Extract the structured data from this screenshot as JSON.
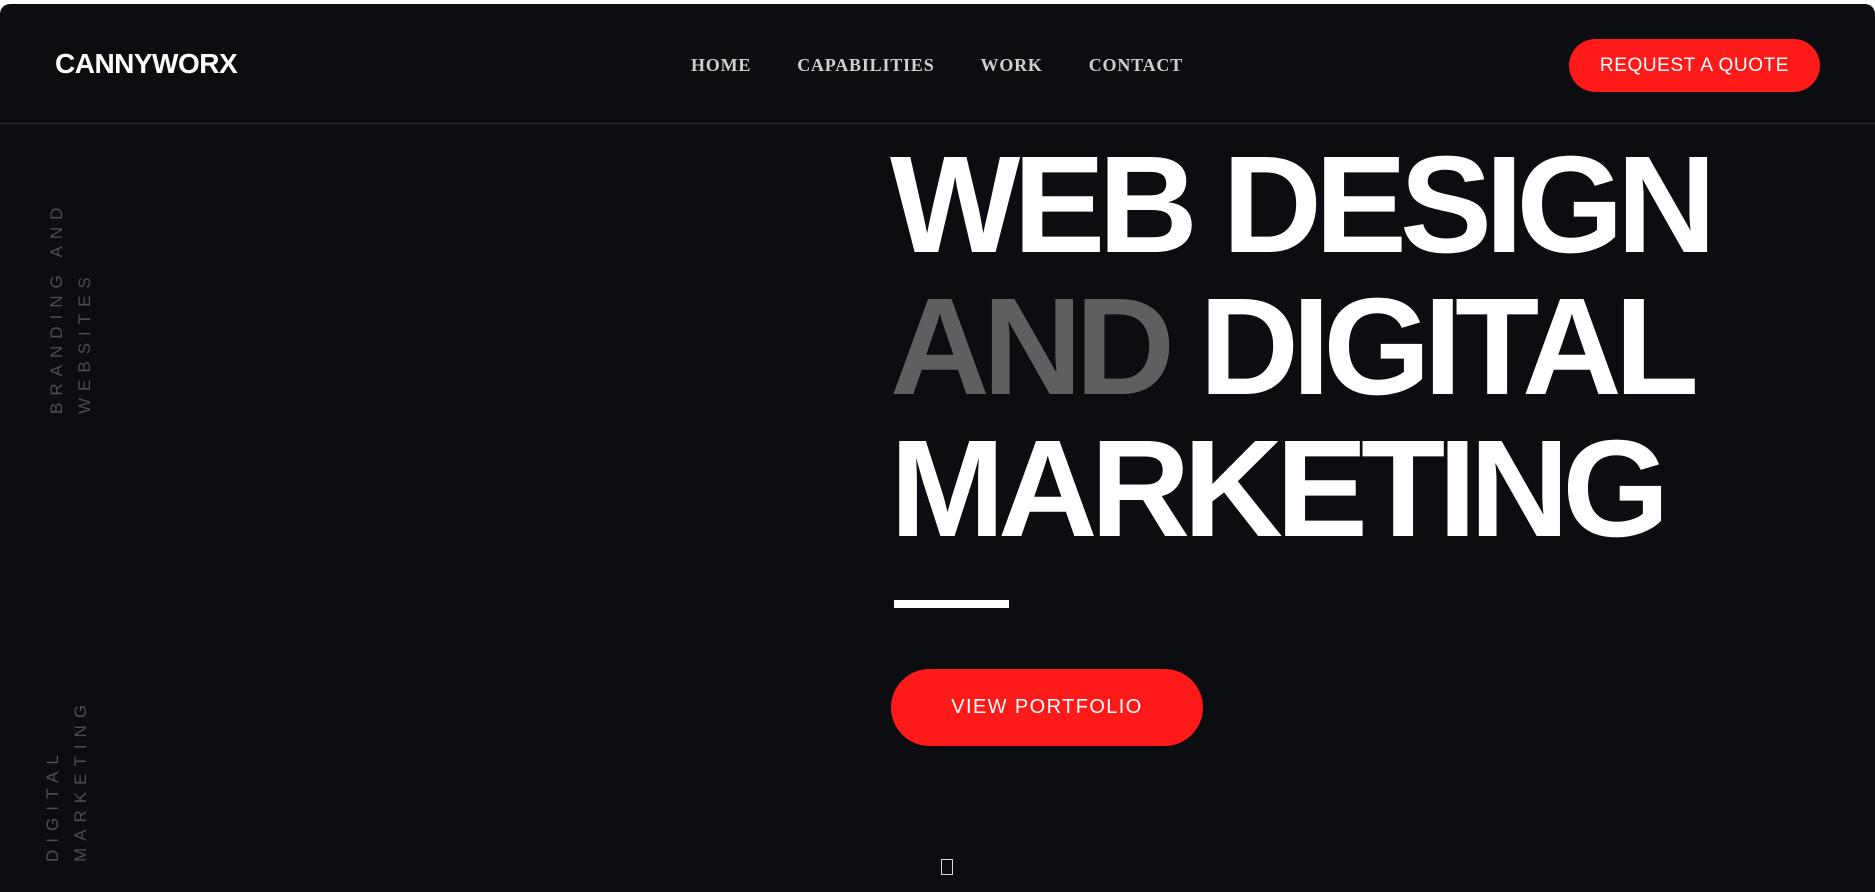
{
  "brand": {
    "logo": "CANNYWORX"
  },
  "nav": {
    "items": [
      {
        "label": "HOME"
      },
      {
        "label": "CAPABILITIES"
      },
      {
        "label": "WORK"
      },
      {
        "label": "CONTACT"
      }
    ],
    "cta_label": "REQUEST A QUOTE"
  },
  "side": {
    "top_label": "BRANDING AND WEBSITES",
    "bottom_label": "DIGITAL MARKETING"
  },
  "hero": {
    "line1": "WEB DESIGN",
    "line2_muted": "AND",
    "line2_rest": " DIGITAL",
    "line3": "MARKETING",
    "button_label": "VIEW PORTFOLIO"
  },
  "colors": {
    "background": "#0c0d10",
    "accent": "#ff1a1a",
    "muted_text": "#5f5f5f"
  },
  "icons": {
    "scroll": "scroll-down-icon"
  }
}
